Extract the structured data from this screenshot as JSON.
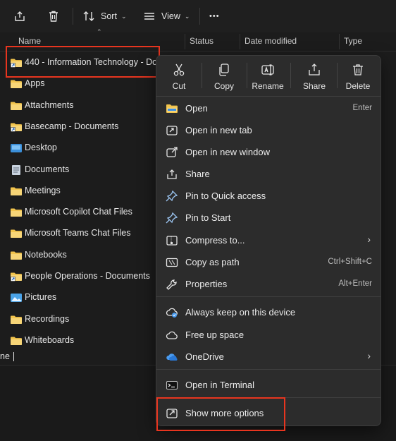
{
  "toolbar": {
    "sort_label": "Sort",
    "view_label": "View",
    "more_symbol": "•••"
  },
  "columns": {
    "name": "Name",
    "status": "Status",
    "date_modified": "Date modified",
    "type": "Type"
  },
  "files": [
    {
      "name": "440 - Information Technology - Doc",
      "icon": "shortcut-folder-icon"
    },
    {
      "name": "Apps",
      "icon": "folder-icon"
    },
    {
      "name": "Attachments",
      "icon": "folder-icon"
    },
    {
      "name": "Basecamp - Documents",
      "icon": "shortcut-folder-icon"
    },
    {
      "name": "Desktop",
      "icon": "desktop-folder-icon"
    },
    {
      "name": "Documents",
      "icon": "documents-folder-icon"
    },
    {
      "name": "Meetings",
      "icon": "folder-icon"
    },
    {
      "name": "Microsoft Copilot Chat Files",
      "icon": "folder-icon"
    },
    {
      "name": "Microsoft Teams Chat Files",
      "icon": "folder-icon"
    },
    {
      "name": "Notebooks",
      "icon": "folder-icon"
    },
    {
      "name": "People Operations - Documents",
      "icon": "shortcut-folder-icon"
    },
    {
      "name": "Pictures",
      "icon": "pictures-folder-icon"
    },
    {
      "name": "Recordings",
      "icon": "folder-icon"
    },
    {
      "name": "Whiteboards",
      "icon": "folder-icon"
    }
  ],
  "status_bar": {
    "text": "ne"
  },
  "context_menu": {
    "quick_actions": [
      {
        "label": "Cut",
        "icon": "scissors-icon"
      },
      {
        "label": "Copy",
        "icon": "copy-icon"
      },
      {
        "label": "Rename",
        "icon": "rename-icon"
      },
      {
        "label": "Share",
        "icon": "share-icon"
      },
      {
        "label": "Delete",
        "icon": "trash-icon"
      }
    ],
    "items": [
      {
        "label": "Open",
        "shortcut": "Enter",
        "icon": "folder-open-icon"
      },
      {
        "label": "Open in new tab",
        "shortcut": "",
        "icon": "new-tab-icon"
      },
      {
        "label": "Open in new window",
        "shortcut": "",
        "icon": "new-window-icon"
      },
      {
        "label": "Share",
        "shortcut": "",
        "icon": "share-icon"
      },
      {
        "label": "Pin to Quick access",
        "shortcut": "",
        "icon": "pin-icon"
      },
      {
        "label": "Pin to Start",
        "shortcut": "",
        "icon": "pin-icon"
      },
      {
        "label": "Compress to...",
        "shortcut": "",
        "icon": "zip-icon",
        "submenu": true
      },
      {
        "label": "Copy as path",
        "shortcut": "Ctrl+Shift+C",
        "icon": "copy-path-icon"
      },
      {
        "label": "Properties",
        "shortcut": "Alt+Enter",
        "icon": "wrench-icon"
      },
      {
        "label": "Always keep on this device",
        "shortcut": "",
        "icon": "cloud-sync-icon"
      },
      {
        "label": "Free up space",
        "shortcut": "",
        "icon": "cloud-icon"
      },
      {
        "label": "OneDrive",
        "shortcut": "",
        "icon": "onedrive-icon",
        "submenu": true
      },
      {
        "label": "Open in Terminal",
        "shortcut": "",
        "icon": "terminal-icon"
      },
      {
        "label": "Show more options",
        "shortcut": "",
        "icon": "show-more-icon"
      }
    ],
    "submenu_arrow": "›"
  },
  "colors": {
    "background": "#1c1c1c",
    "menu_background": "#2c2c2c",
    "highlight_annotation": "#e8351f",
    "folder_yellow": "#f2c44d",
    "onedrive_blue": "#4a9cf0"
  }
}
